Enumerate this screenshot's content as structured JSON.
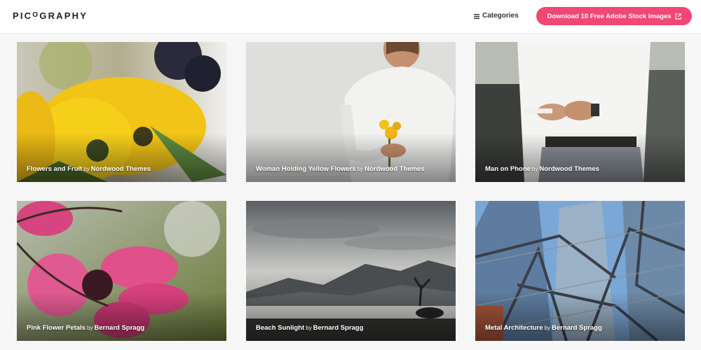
{
  "header": {
    "logo_text": "PICOGRAPHY",
    "categories_label": "Categories",
    "cta_label": "Download 10 Free Adobe Stock Images"
  },
  "icons": {
    "menu": "hamburger-icon",
    "external": "external-link-icon"
  },
  "colors": {
    "accent": "#f24674",
    "header_bg": "#ffffff",
    "page_bg": "#f6f6f6"
  },
  "photos": [
    {
      "title": "Flowers and Fruit",
      "by": "by",
      "author": "Nordwood Themes"
    },
    {
      "title": "Woman Holding Yellow Flowers",
      "by": "by",
      "author": "Nordwood Themes"
    },
    {
      "title": "Man on Phone",
      "by": "by",
      "author": "Nordwood Themes"
    },
    {
      "title": "Pink Flower Petals",
      "by": "by",
      "author": "Bernard Spragg"
    },
    {
      "title": "Beach Sunlight",
      "by": "by",
      "author": "Bernard Spragg"
    },
    {
      "title": "Metal Architecture",
      "by": "by",
      "author": "Bernard Spragg"
    }
  ]
}
